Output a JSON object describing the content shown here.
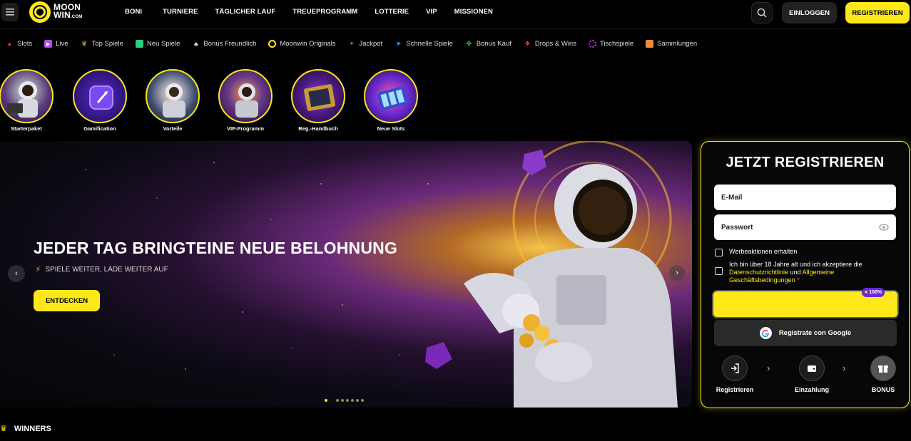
{
  "header": {
    "logo_line1": "MOON",
    "logo_line2": "WIN",
    "logo_suffix": ".COM",
    "nav": [
      "BONI",
      "TURNIERE",
      "TÄGLICHER LAUF",
      "TREUEPROGRAMM",
      "LOTTERIE",
      "VIP",
      "MISSIONEN"
    ],
    "login_label": "EINLOGGEN",
    "register_label": "REGISTRIEREN"
  },
  "categories": [
    {
      "label": "Slots",
      "icon": "cherry-icon",
      "color": "#e0304a"
    },
    {
      "label": "Live",
      "icon": "live-play-icon",
      "color": "#b04af0"
    },
    {
      "label": "Top Spiele",
      "icon": "trophy-icon",
      "color": "#f5c518"
    },
    {
      "label": "Neu Spiele",
      "icon": "calendar-icon",
      "color": "#2fce7a"
    },
    {
      "label": "Bonus Freundlich",
      "icon": "cards-icon",
      "color": "#dddddd"
    },
    {
      "label": "Moonwin Originals",
      "icon": "moon-icon",
      "color": "#ffe81a"
    },
    {
      "label": "Jackpot",
      "icon": "jackpot-icon",
      "color": "#c04ae0"
    },
    {
      "label": "Schnelle Spiele",
      "icon": "rocket-icon",
      "color": "#3aa0f5"
    },
    {
      "label": "Bonus Kauf",
      "icon": "clover-icon",
      "color": "#2fce4a"
    },
    {
      "label": "Drops & Wins",
      "icon": "drops-icon",
      "color": "#f04a3a"
    },
    {
      "label": "Tischspiele",
      "icon": "chip-icon",
      "color": "#c04ae0"
    },
    {
      "label": "Sammlungen",
      "icon": "collection-icon",
      "color": "#f08a3a"
    }
  ],
  "circles": [
    {
      "label": "Starterpaket"
    },
    {
      "label": "Gamification"
    },
    {
      "label": "Vorteile"
    },
    {
      "label": "VIP-Programm"
    },
    {
      "label": "Reg.-Handbuch"
    },
    {
      "label": "Neue Slots"
    }
  ],
  "hero": {
    "title": "JEDER TAG BRINGTEINE NEUE BELOHNUNG",
    "subtitle": "SPIELE WEITER, LADE WEITER AUF",
    "cta": "ENTDECKEN",
    "slides": 7,
    "active_slide": 1
  },
  "register": {
    "title": "JETZT REGISTRIEREN",
    "email_placeholder": "E-Mail",
    "password_placeholder": "Passwort",
    "promo_label": "Werbeaktionen erhalten",
    "terms_prefix": "Ich bin über 18 Jahre alt und ich akzeptiere die",
    "privacy_link": "Datenschutzrichtlinie",
    "and_word": "und",
    "terms_link": "Allgemeine Geschäftsbedingungen",
    "required_mark": "*",
    "bonus_badge": "100%",
    "google_label": "Registrate con Google",
    "steps": [
      "Registrieren",
      "Einzahlung",
      "BONUS"
    ]
  },
  "winners": {
    "title": "WINNERS"
  },
  "colors": {
    "accent": "#ffe81a",
    "background": "#000000",
    "panel": "#070707"
  }
}
